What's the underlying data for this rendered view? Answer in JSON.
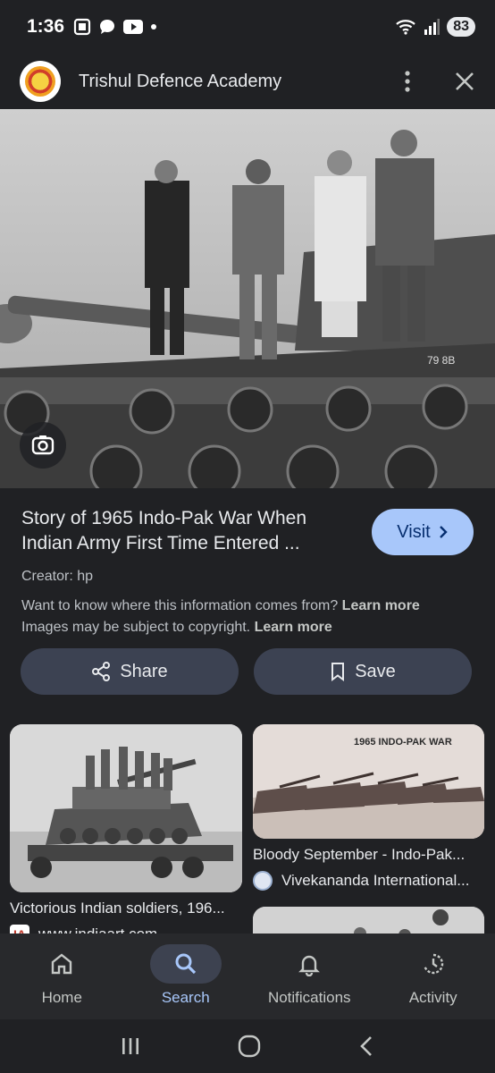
{
  "status": {
    "time": "1:36",
    "battery": "83"
  },
  "app": {
    "title": "Trishul Defence Academy"
  },
  "result": {
    "title_line1": "Story of 1965 Indo-Pak War When",
    "title_line2": "Indian Army First Time Entered ...",
    "visit_label": "Visit",
    "creator": "Creator: hp",
    "info_text": "Want to know where this information comes from?",
    "copyright_text": "Images may be subject to copyright.",
    "learn_more": "Learn more"
  },
  "actions": {
    "share": "Share",
    "save": "Save"
  },
  "related": [
    {
      "title": "Victorious Indian soldiers, 196...",
      "source": "www.indiaart.com",
      "source_icon_text": "IA"
    },
    {
      "title": "Bloody September - Indo-Pak...",
      "source": "Vivekananda International...",
      "image_caption": "1965 INDO-PAK WAR"
    }
  ],
  "hero": {
    "tank_marking": "79 8B"
  },
  "nav": [
    {
      "label": "Home",
      "icon": "home-icon"
    },
    {
      "label": "Search",
      "icon": "search-icon"
    },
    {
      "label": "Notifications",
      "icon": "bell-icon"
    },
    {
      "label": "Activity",
      "icon": "history-icon"
    }
  ]
}
